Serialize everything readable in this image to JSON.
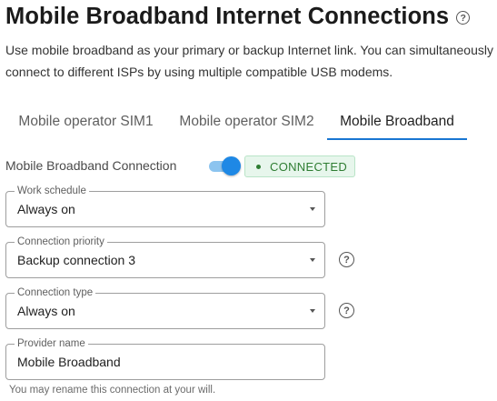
{
  "page": {
    "title": "Mobile Broadband Internet Connections",
    "help_symbol": "?",
    "description": "Use mobile broadband as your primary or backup Internet link. You can simultaneously connect to different ISPs by using multiple compatible USB modems."
  },
  "tabs": [
    {
      "label": "Mobile operator SIM1",
      "active": false
    },
    {
      "label": "Mobile operator SIM2",
      "active": false
    },
    {
      "label": "Mobile Broadband",
      "active": true
    }
  ],
  "connection": {
    "label": "Mobile Broadband Connection",
    "enabled": true,
    "status": "CONNECTED"
  },
  "fields": {
    "work_schedule": {
      "label": "Work schedule",
      "value": "Always on"
    },
    "connection_priority": {
      "label": "Connection priority",
      "value": "Backup connection 3"
    },
    "connection_type": {
      "label": "Connection type",
      "value": "Always on"
    },
    "provider_name": {
      "label": "Provider name",
      "value": "Mobile Broadband"
    }
  },
  "help_symbol": "?",
  "hint": "You may rename this connection at your will.",
  "colors": {
    "accent": "#1976d2",
    "toggle_thumb": "#1e88e5",
    "status_bg": "#e7f6ec",
    "status_text": "#2e7d32"
  },
  "icons": {
    "title_help": "help-circle-icon",
    "field_help": "help-circle-icon",
    "dropdown": "caret-down-icon",
    "status": "status-dot-icon"
  }
}
